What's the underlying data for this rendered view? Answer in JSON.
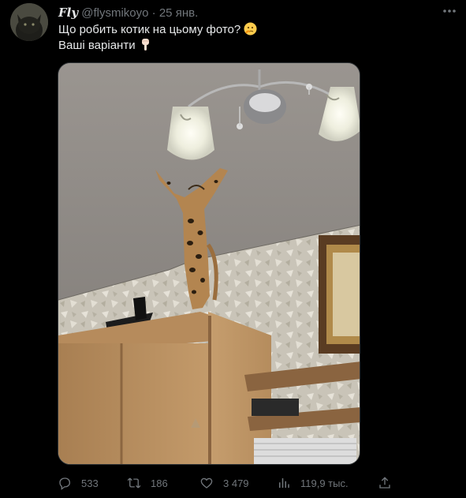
{
  "tweet": {
    "author_name": "𝑭𝒍𝒚",
    "handle": "@flysmikoyo",
    "separator": "·",
    "date": "25 янв.",
    "text_line1": "Що робить котик на цьому фото?",
    "text_line1_emoji": "🤔",
    "text_line2": "Ваші варіанти",
    "text_line2_emoji": "👇"
  },
  "actions": {
    "replies": "533",
    "retweets": "186",
    "likes": "3 479",
    "views": "119,9 тыс."
  },
  "icons": {
    "reply": "reply-icon",
    "retweet": "retweet-icon",
    "like": "heart-icon",
    "views": "views-chart-icon",
    "share": "share-icon",
    "more": "more-dots-icon"
  },
  "colors": {
    "background": "#000000",
    "text_primary": "#e7e9ea",
    "text_secondary": "#71767b",
    "border": "#2f3336"
  }
}
